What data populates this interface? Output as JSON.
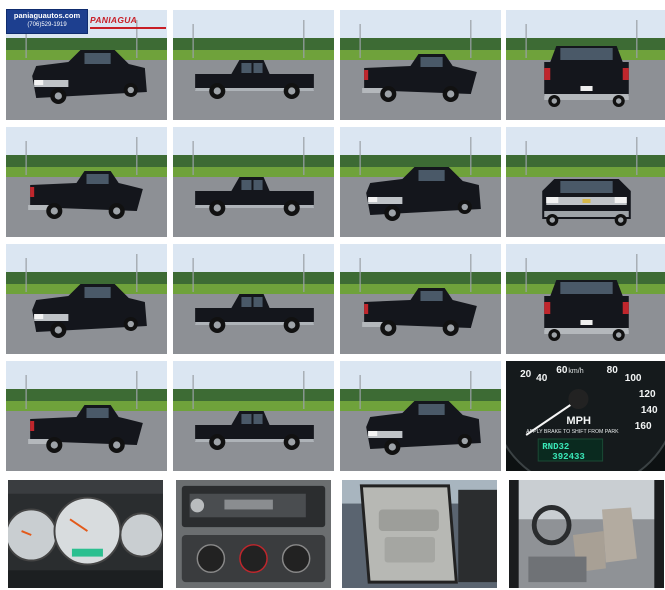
{
  "dealer": {
    "website": "paniaguautos.com",
    "phone": "(706)529-1919",
    "brand": "PANIAGUA"
  },
  "photos": [
    {
      "name": "photo-front-left-1",
      "kind": "truck",
      "view": "front-left"
    },
    {
      "name": "photo-side-left-1",
      "kind": "truck",
      "view": "side-left"
    },
    {
      "name": "photo-rear-left-1",
      "kind": "truck",
      "view": "rear-left"
    },
    {
      "name": "photo-rear-1",
      "kind": "truck",
      "view": "rear"
    },
    {
      "name": "photo-rear-left-2",
      "kind": "truck",
      "view": "rear-left"
    },
    {
      "name": "photo-side-left-2",
      "kind": "truck",
      "view": "side-left"
    },
    {
      "name": "photo-front-right-1",
      "kind": "truck",
      "view": "front-right"
    },
    {
      "name": "photo-front-1",
      "kind": "truck",
      "view": "front"
    },
    {
      "name": "photo-front-left-2",
      "kind": "truck",
      "view": "front-left"
    },
    {
      "name": "photo-side-left-3",
      "kind": "truck",
      "view": "side-left"
    },
    {
      "name": "photo-rear-right-1",
      "kind": "truck",
      "view": "rear-right"
    },
    {
      "name": "photo-rear-2",
      "kind": "truck",
      "view": "rear"
    },
    {
      "name": "photo-rear-left-3",
      "kind": "truck",
      "view": "rear-left"
    },
    {
      "name": "photo-side-left-4",
      "kind": "truck",
      "view": "side-left"
    },
    {
      "name": "photo-front-right-2",
      "kind": "truck",
      "view": "front-right"
    },
    {
      "name": "photo-speedometer",
      "kind": "speedo"
    },
    {
      "name": "photo-instrument-cluster",
      "kind": "cluster"
    },
    {
      "name": "photo-stereo-controls",
      "kind": "stereo"
    },
    {
      "name": "photo-door-panel",
      "kind": "door"
    },
    {
      "name": "photo-front-seats",
      "kind": "seats"
    }
  ],
  "speedometer": {
    "mph_ticks": [
      "20",
      "40",
      "60",
      "80",
      "100",
      "120",
      "140",
      "160"
    ],
    "unit_top": "km/h",
    "unit": "MPH",
    "notice": "APPLY BRAKE TO SHIFT FROM PARK",
    "gear": "RND32",
    "odometer": "392433"
  },
  "colors": {
    "sky": "#dbe6f2",
    "trees": "#3d6b34",
    "grass": "#6fa23b",
    "asphalt": "#8d9095",
    "truck": "#14161c"
  }
}
